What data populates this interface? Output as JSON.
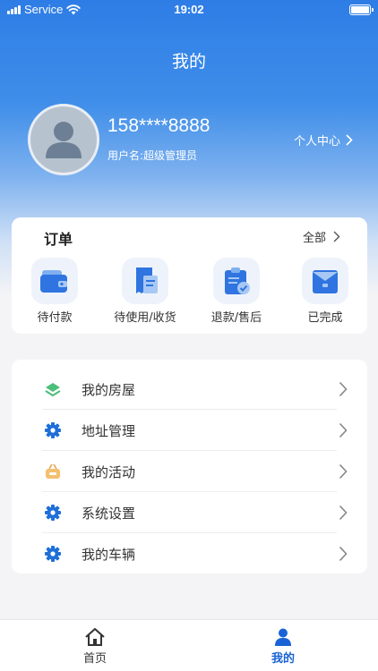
{
  "status_bar": {
    "carrier": "Service",
    "time": "19:02"
  },
  "header": {
    "title": "我的"
  },
  "profile": {
    "phone": "158****8888",
    "username": "用户名:超级管理员",
    "center_link": "个人中心"
  },
  "orders": {
    "title": "订单",
    "all_label": "全部",
    "items": [
      {
        "label": "待付款",
        "icon": "wallet-icon"
      },
      {
        "label": "待使用/收货",
        "icon": "receipt-icon"
      },
      {
        "label": "退款/售后",
        "icon": "clipboard-check-icon"
      },
      {
        "label": "已完成",
        "icon": "envelope-icon"
      }
    ]
  },
  "menu": {
    "items": [
      {
        "label": "我的房屋",
        "icon": "house-layers-icon"
      },
      {
        "label": "地址管理",
        "icon": "gear-icon"
      },
      {
        "label": "我的活动",
        "icon": "basket-icon"
      },
      {
        "label": "系统设置",
        "icon": "gear-icon"
      },
      {
        "label": "我的车辆",
        "icon": "gear-icon"
      }
    ]
  },
  "tabbar": {
    "items": [
      {
        "label": "首页",
        "icon": "home-icon",
        "active": false
      },
      {
        "label": "我的",
        "icon": "person-icon",
        "active": true
      }
    ]
  },
  "colors": {
    "accent": "#2e7de6",
    "active_tab": "#1a63d6",
    "inactive_tab": "#333333"
  }
}
